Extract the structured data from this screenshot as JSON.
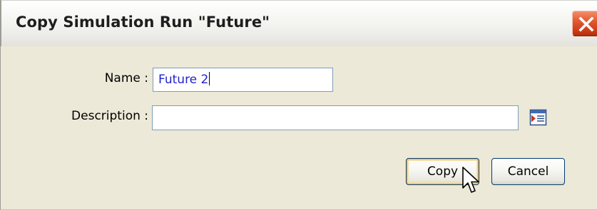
{
  "dialog": {
    "title": "Copy Simulation Run \"Future\"",
    "close_icon": "close-icon"
  },
  "form": {
    "name_label": "Name :",
    "name_value": "Future 2",
    "description_label": "Description :",
    "description_value": "",
    "description_browse_icon": "browse-list-icon"
  },
  "buttons": {
    "copy_label": "Copy",
    "cancel_label": "Cancel"
  },
  "colors": {
    "dialog_background": "#ece9d8",
    "close_button": "#e25a32",
    "input_text": "#2222cc",
    "input_border": "#7f9db9",
    "button_border": "#003c74",
    "default_button_highlight": "#f6c46a"
  }
}
